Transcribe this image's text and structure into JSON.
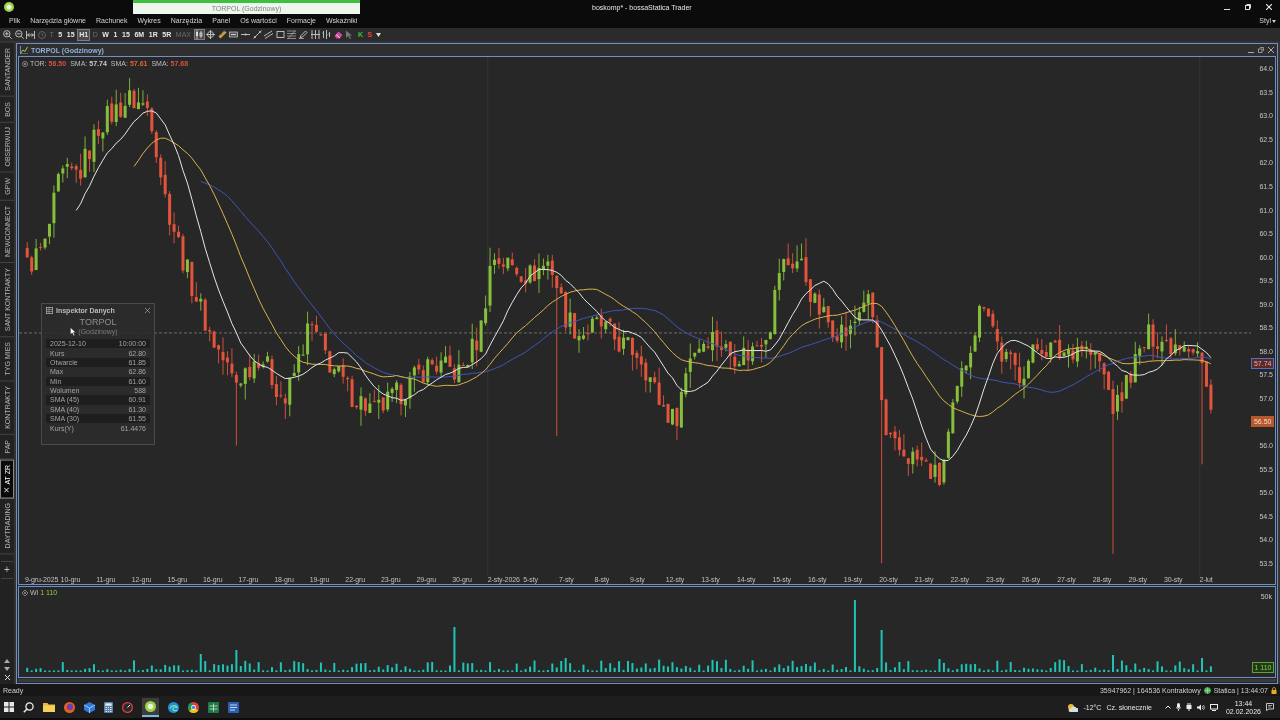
{
  "window": {
    "title": "boskomp* - bossaStatica Trader",
    "document_tab": "TORPOL (Godzinowy)"
  },
  "menu": [
    {
      "label": "Plik"
    },
    {
      "label": "Narzędzia główne"
    },
    {
      "label": "Rachunek"
    },
    {
      "label": "Wykres"
    },
    {
      "label": "Narzędzia"
    },
    {
      "label": "Panel"
    },
    {
      "label": "Oś wartości"
    },
    {
      "label": "Formacje"
    },
    {
      "label": "Wskaźniki"
    }
  ],
  "style_menu": {
    "label": "Styl"
  },
  "toolbar": {
    "intervals": [
      {
        "label": "T",
        "selected": false,
        "disabled": true
      },
      {
        "label": "5",
        "selected": false,
        "disabled": false
      },
      {
        "label": "15",
        "selected": false,
        "disabled": false
      },
      {
        "label": "H1",
        "selected": true,
        "disabled": false
      },
      {
        "label": "D",
        "selected": false,
        "disabled": true
      },
      {
        "label": "W",
        "selected": false,
        "disabled": false
      },
      {
        "label": "1",
        "selected": false,
        "disabled": false
      },
      {
        "label": "15",
        "selected": false,
        "disabled": false
      },
      {
        "label": "6M",
        "selected": false,
        "disabled": false
      },
      {
        "label": "1R",
        "selected": false,
        "disabled": false
      },
      {
        "label": "5R",
        "selected": false,
        "disabled": false
      },
      {
        "label": "MAX",
        "selected": false,
        "disabled": true
      }
    ],
    "order_buttons": [
      {
        "label": "K",
        "kind": "buy"
      },
      {
        "label": "S",
        "kind": "sell"
      }
    ]
  },
  "sidebar": {
    "tabs": [
      {
        "label": "SANTANDER",
        "selected": false
      },
      {
        "label": "BOS",
        "selected": false
      },
      {
        "label": "OBSERWUJ",
        "selected": false
      },
      {
        "label": "GPW",
        "selected": false
      },
      {
        "label": "NEWCONNECT",
        "selected": false
      },
      {
        "label": "SANT KONTRAKTY",
        "selected": false
      },
      {
        "label": "TYG MIES",
        "selected": false
      },
      {
        "label": "KONTRAKTY",
        "selected": false
      },
      {
        "label": "PAP",
        "selected": false
      },
      {
        "label": "AT ZR",
        "selected": true
      },
      {
        "label": "DAYTRADING",
        "selected": false
      }
    ],
    "add_button": "+"
  },
  "chart_window": {
    "title": "TORPOL (Godzinowy)",
    "legend": [
      {
        "name": "TOR:",
        "value": "56.50",
        "color": "#d9503f"
      },
      {
        "name": "SMA:",
        "value": "57.74",
        "color": "#c8c8c8"
      },
      {
        "name": "SMA:",
        "value": "57.61",
        "color": "#e0603a"
      },
      {
        "name": "SMA:",
        "value": "57.68",
        "color": "#d9503f"
      }
    ],
    "price_axis": [
      "64.0",
      "63.5",
      "63.0",
      "62.5",
      "62.0",
      "61.5",
      "61.0",
      "60.5",
      "60.0",
      "59.5",
      "59.0",
      "58.5",
      "58.0",
      "57.5",
      "57.0",
      "56.0",
      "55.5",
      "55.0",
      "54.5",
      "54.0",
      "53.5"
    ],
    "price_tags": [
      {
        "value": "57.74",
        "kind": "indicator"
      },
      {
        "value": "56.50",
        "kind": "last"
      }
    ],
    "date_axis": [
      "9-gru-2025",
      "10-gru",
      "11-gru",
      "12-gru",
      "15-gru",
      "16-gru",
      "17-gru",
      "18-gru",
      "19-gru",
      "22-gru",
      "23-gru",
      "29-gru",
      "30-gru",
      "2-sty-2026",
      "5-sty",
      "7-sty",
      "8-sty",
      "9-sty",
      "12-sty",
      "13-sty",
      "14-sty",
      "15-sty",
      "16-sty",
      "19-sty",
      "20-sty",
      "21-sty",
      "22-sty",
      "23-sty",
      "26-sty",
      "27-sty",
      "28-sty",
      "29-sty",
      "30-sty",
      "2-lut"
    ],
    "inspector": {
      "title": "Inspektor Danych",
      "symbol": "TORPOL",
      "interval": "(Godzinowy)",
      "date": "2025-12-10",
      "time": "10:00:00",
      "rows": [
        {
          "label": "Kurs",
          "value": "62.80"
        },
        {
          "label": "Otwarcie",
          "value": "61.85"
        },
        {
          "label": "Max",
          "value": "62.86"
        },
        {
          "label": "Min",
          "value": "61.60"
        },
        {
          "label": "Wolumen",
          "value": "588"
        },
        {
          "label": "SMA (45)",
          "value": "60.91"
        },
        {
          "label": "SMA (40)",
          "value": "61.30"
        },
        {
          "label": "SMA (30)",
          "value": "61.55"
        },
        {
          "label": "Kurs(Y)",
          "value": "61.4476"
        }
      ]
    },
    "volume_pane": {
      "legend_name": "Wl",
      "legend_value": "1 110",
      "axis_label": "50k",
      "value_tag": "1 110"
    }
  },
  "status_bar": {
    "state": "Ready",
    "account": "35947962 | 164536 Kontraktowy",
    "server": "Statica | 13:44:07"
  },
  "taskbar": {
    "temperature": "-12°C",
    "weather": "Cz. słonecznie",
    "time": "13:44",
    "date": "02.02.2026"
  }
}
